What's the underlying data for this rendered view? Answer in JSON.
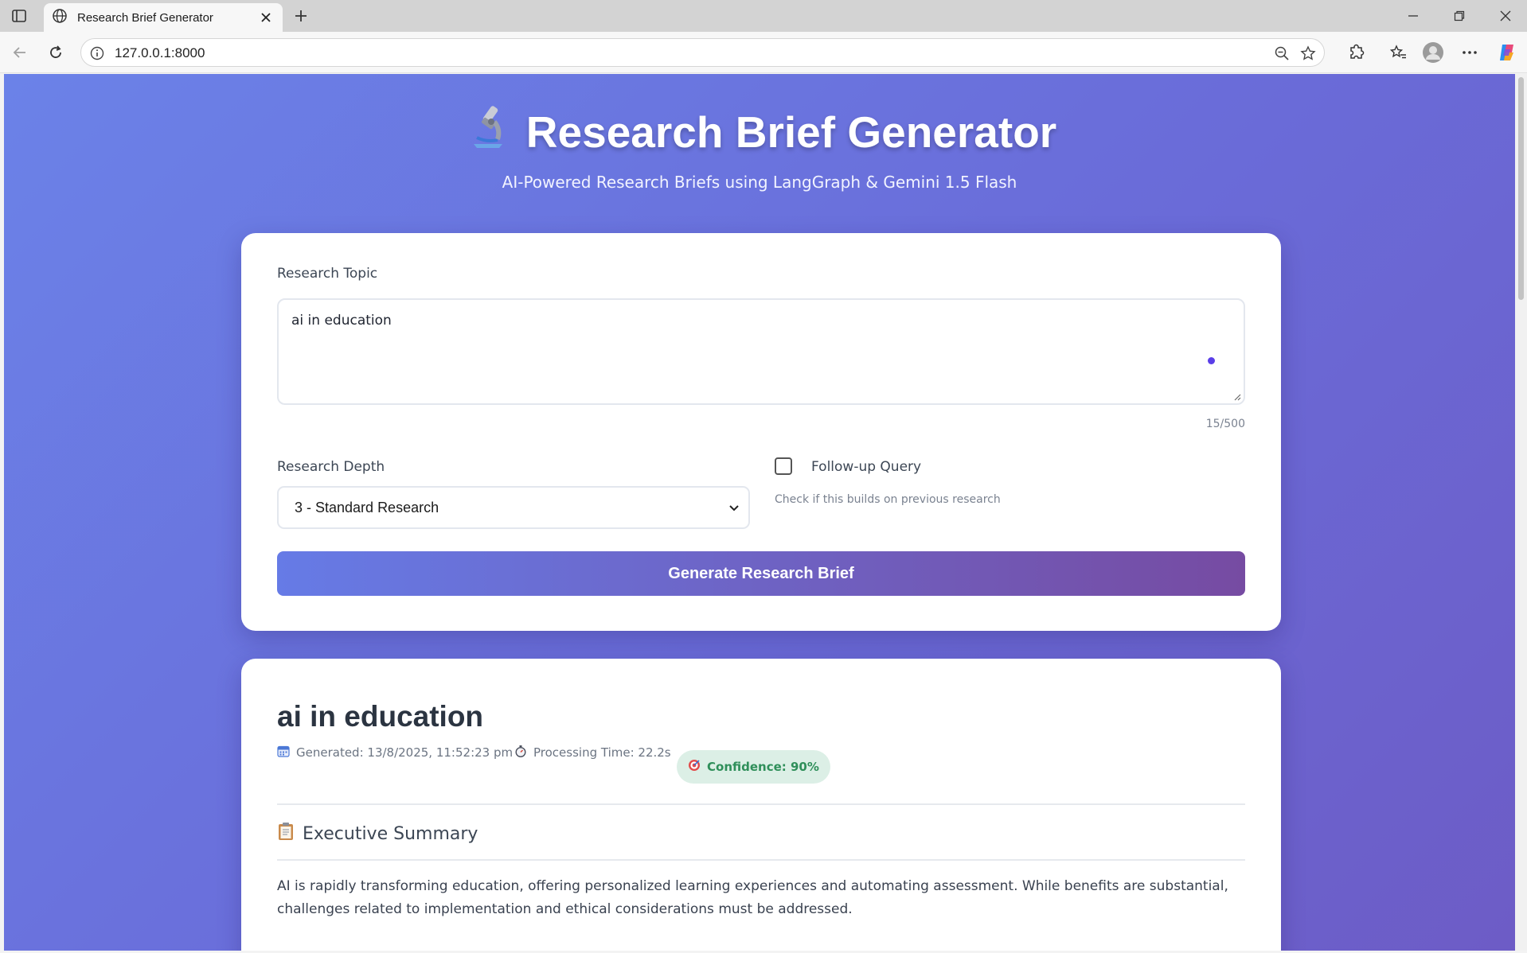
{
  "browser": {
    "tab_title": "Research Brief Generator",
    "url": "127.0.0.1:8000"
  },
  "header": {
    "title": "Research Brief Generator",
    "subtitle": "AI-Powered Research Briefs using LangGraph & Gemini 1.5 Flash",
    "icon": "microscope-icon"
  },
  "form": {
    "topic_label": "Research Topic",
    "topic_value": "ai in education",
    "char_counter": "15/500",
    "depth_label": "Research Depth",
    "depth_selected": "3 - Standard Research",
    "followup_label": "Follow-up Query",
    "followup_checked": false,
    "followup_help": "Check if this builds on previous research",
    "submit_label": "Generate Research Brief"
  },
  "result": {
    "title": "ai in education",
    "generated": "Generated: 13/8/2025, 11:52:23 pm",
    "processing_time": "Processing Time: 22.2s",
    "confidence": "Confidence: 90%",
    "section_title": "Executive Summary",
    "summary": "AI is rapidly transforming education, offering personalized learning experiences and automating assessment. While benefits are substantial, challenges related to implementation and ethical considerations must be addressed."
  },
  "colors": {
    "gradient_start": "#667eea",
    "gradient_end": "#764ba2",
    "confidence_bg": "#dcefe6",
    "confidence_text": "#2f8f5a"
  }
}
